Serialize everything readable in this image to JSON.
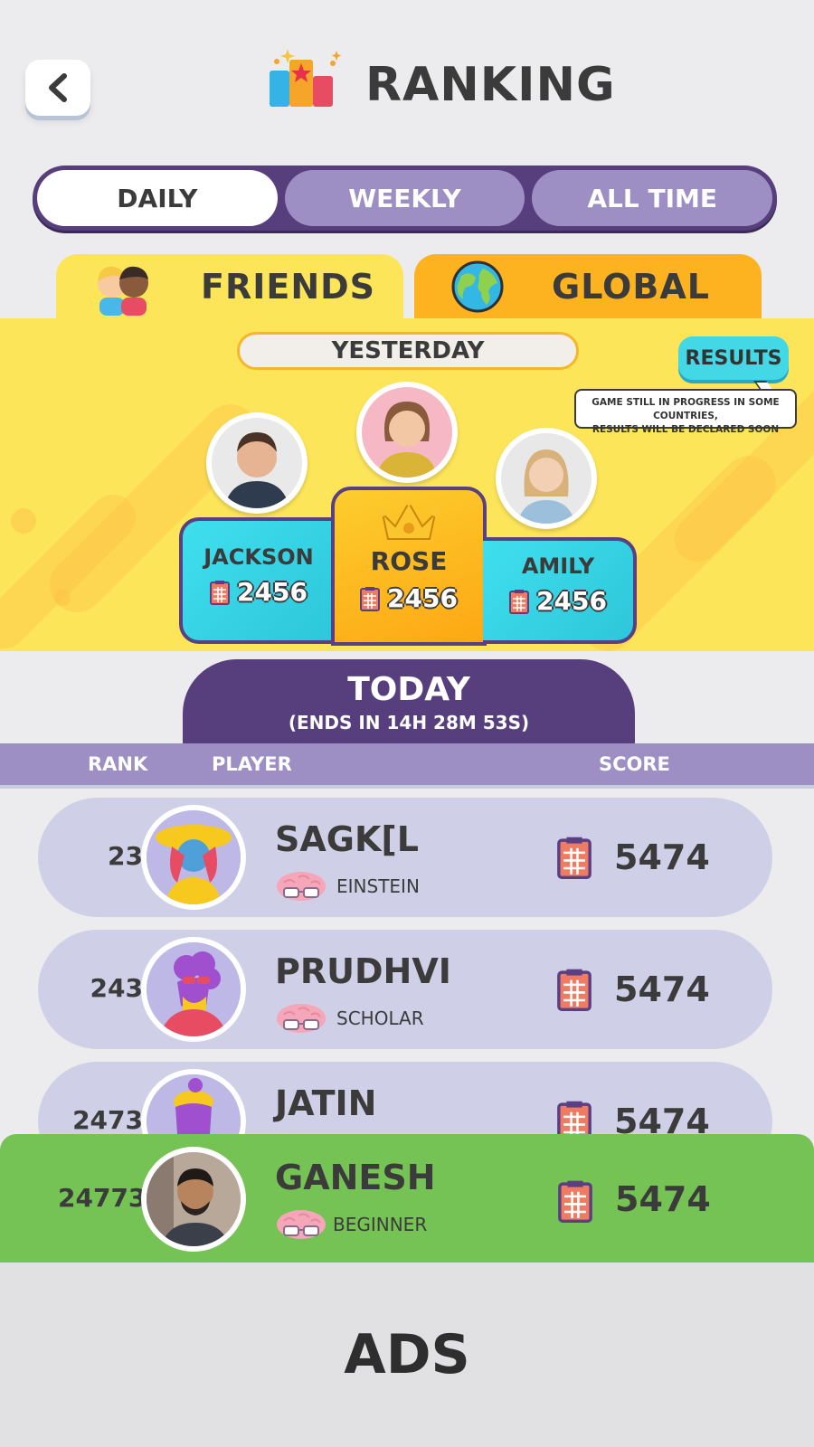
{
  "header": {
    "title": "RANKING",
    "back_icon": "chevron-left-icon"
  },
  "period_tabs": [
    {
      "label": "DAILY",
      "active": true
    },
    {
      "label": "WEEKLY",
      "active": false
    },
    {
      "label": "ALL TIME",
      "active": false
    }
  ],
  "scope_tabs": {
    "friends": {
      "label": "FRIENDS",
      "icon": "friends-icon"
    },
    "global": {
      "label": "GLOBAL",
      "icon": "globe-icon"
    }
  },
  "podium": {
    "period_label": "YESTERDAY",
    "results_label": "RESULTS",
    "notice": [
      "GAME STILL IN PROGRESS IN SOME COUNTRIES,",
      "RESULTS WILL BE DECLARED SOON"
    ],
    "first": {
      "name": "ROSE",
      "score": "2456"
    },
    "second": {
      "name": "JACKSON",
      "score": "2456"
    },
    "third": {
      "name": "AMILY",
      "score": "2456"
    }
  },
  "today": {
    "title": "TODAY",
    "subtitle": "(ENDS IN  14H 28M 53S)"
  },
  "columns": {
    "rank": "RANK",
    "player": "PLAYER",
    "score": "SCORE"
  },
  "rows": [
    {
      "rank": "23",
      "name": "SAGK[L",
      "title": "EINSTEIN",
      "score": "5474"
    },
    {
      "rank": "243",
      "name": "PRUDHVI",
      "title": "SCHOLAR",
      "score": "5474"
    },
    {
      "rank": "2473",
      "name": "JATIN",
      "title": "",
      "score": "5474"
    }
  ],
  "current_user": {
    "rank": "24773",
    "name": "GANESH",
    "title": "BEGINNER",
    "score": "5474"
  },
  "ads": {
    "label": "ADS"
  },
  "colors": {
    "purple": "#563f7c",
    "lavender": "#9d8ec3",
    "yellow": "#fde55a",
    "orange": "#fdb220",
    "cyan": "#3fdfee",
    "green": "#75c255"
  }
}
